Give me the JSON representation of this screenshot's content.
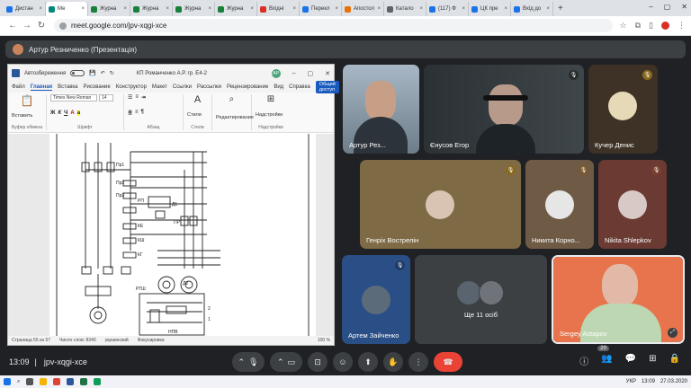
{
  "browser": {
    "tabs": [
      {
        "label": "Дистан",
        "color": "#1a73e8"
      },
      {
        "label": "Ме",
        "color": "#00897b",
        "active": true
      },
      {
        "label": "Журна",
        "color": "#188038"
      },
      {
        "label": "Журна",
        "color": "#188038"
      },
      {
        "label": "Журна",
        "color": "#188038"
      },
      {
        "label": "Журна",
        "color": "#188038"
      },
      {
        "label": "Вхідні",
        "color": "#d93025"
      },
      {
        "label": "Перекл",
        "color": "#1a73e8"
      },
      {
        "label": "Апостол",
        "color": "#e8710a"
      },
      {
        "label": "Катало",
        "color": "#5f6368"
      },
      {
        "label": "(117) Ф",
        "color": "#1a73e8"
      },
      {
        "label": "ЦК пре",
        "color": "#1a73e8"
      },
      {
        "label": "Вхід до",
        "color": "#1a73e8"
      }
    ],
    "url": "meet.google.com/jpv-xqgi-xce"
  },
  "presenter": {
    "label": "Артур Резниченко (Презентація)"
  },
  "word": {
    "autosave": "Автозбереження",
    "doc_title": "КП Романченко А.Р. гр. Е4-2",
    "user_initials": "АР",
    "menu": [
      "Файл",
      "Главная",
      "Вставка",
      "Рисование",
      "Конструктор",
      "Макет",
      "Ссылки",
      "Рассылки",
      "Рецензирование",
      "Вид",
      "Справка"
    ],
    "share": "Общий доступ",
    "font_name": "Times New Roman",
    "font_size": "14",
    "groups": [
      "Буфер обмена",
      "Шрифт",
      "Абзац",
      "Стили",
      "Надстройки"
    ],
    "paste_label": "Вставить",
    "styles_label": "Стили",
    "edit_label": "Редактирование",
    "addins_label": "Надстройки",
    "status": {
      "page": "Страница 55 из 57",
      "words": "Число слов: 8340",
      "lang": "украинский",
      "focus": "Фокусировка",
      "zoom": "100 %"
    },
    "schematic_labels": [
      "Пр1",
      "Пр2",
      "Пр3",
      "РП",
      "КЕ",
      "Д1",
      "ПР",
      "КШ",
      "КГ",
      "РТШ",
      "Д2",
      "2",
      "1",
      "НПВ"
    ]
  },
  "participants": [
    {
      "name": "Артур Рез...",
      "bg": "#8a9aa8"
    },
    {
      "name": "Єнусов Егор",
      "bg": "#33393d"
    },
    {
      "name": "Кучер Денис",
      "bg": "#3d3225"
    },
    {
      "name": "Генріх Вострелін",
      "bg": "#7e6a45"
    },
    {
      "name": "Никита Корно...",
      "bg": "#6f5a45"
    },
    {
      "name": "Nikita Shlepkov",
      "bg": "#6a3a33"
    },
    {
      "name": "Артем Зайченко",
      "bg": "#2a4f86"
    },
    {
      "name": "Ще 11 осіб",
      "bg": "#3c4043"
    },
    {
      "name": "Sergey Astapov",
      "bg": "#e8744d"
    }
  ],
  "meeting": {
    "time": "13:09",
    "code": "jpv-xqgi-xce",
    "participant_count": "20"
  },
  "taskbar": {
    "clock": "13:09",
    "date": "27.03.2020",
    "lang": "УКР"
  }
}
